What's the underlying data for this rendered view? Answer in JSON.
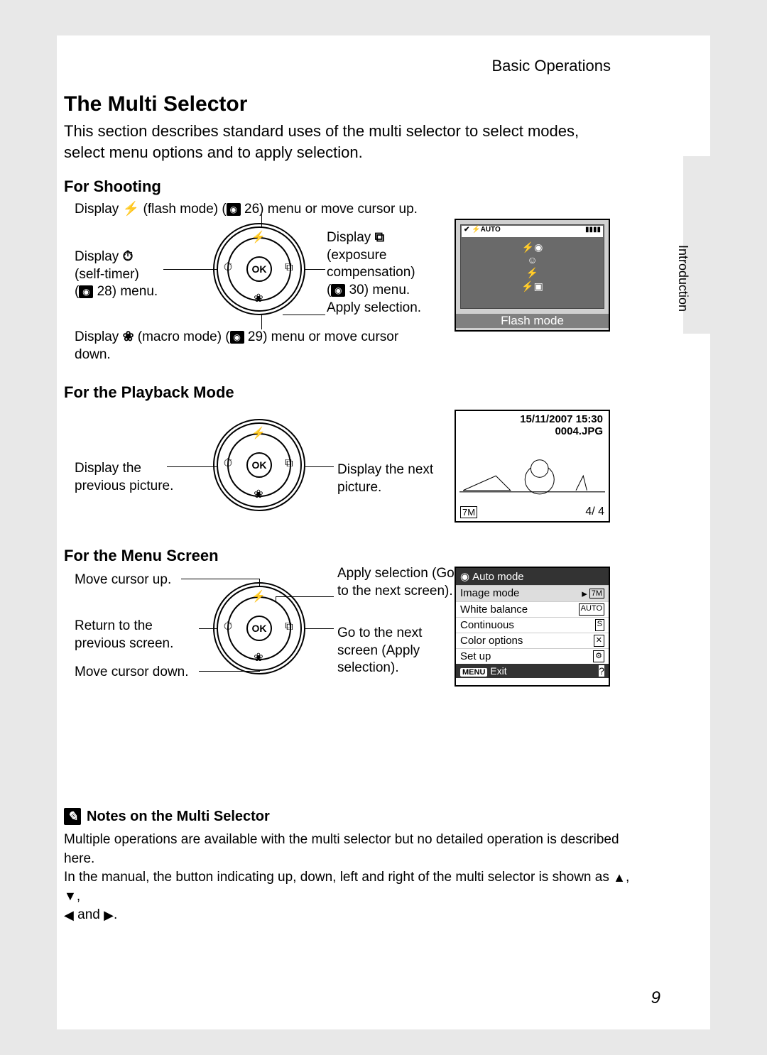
{
  "header": {
    "section": "Basic Operations",
    "sidetab": "Introduction"
  },
  "title": "The Multi Selector",
  "intro": "This section describes standard uses of the multi selector to select modes, select menu options and to apply selection.",
  "shooting": {
    "heading": "For Shooting",
    "top_pre": "Display ",
    "top_mid": " (flash mode) (",
    "top_ref": "26",
    "top_post": ") menu or move cursor up.",
    "left_l1": "Display ",
    "left_l2": "(self-timer)",
    "left_l3_pre": "(",
    "left_l3_ref": "28",
    "left_l3_post": ") menu.",
    "right_l1": "Display ",
    "right_l2": "(exposure",
    "right_l3": "compensation)",
    "right_l4_pre": "(",
    "right_l4_ref": "30",
    "right_l4_post": ") menu.",
    "right_l5": "Apply selection.",
    "bottom_pre": "Display ",
    "bottom_mid": " (macro mode) (",
    "bottom_ref": "29",
    "bottom_post": ") menu or move cursor down."
  },
  "playback": {
    "heading": "For the Playback Mode",
    "left": "Display the previous picture.",
    "right": "Display the next picture."
  },
  "menu": {
    "heading": "For the Menu Screen",
    "left1": "Move cursor up.",
    "left2": "Return to the previous screen.",
    "left3": "Move cursor down.",
    "right1": "Apply selection (Go to the next screen).",
    "right2": "Go to the next screen (Apply selection)."
  },
  "wheel": {
    "ok": "OK"
  },
  "screen_shoot": {
    "top_left": "✔ ⚡AUTO",
    "label": "Flash mode"
  },
  "screen_playback": {
    "date": "15/11/2007 15:30",
    "file": "0004.JPG",
    "res": "7M",
    "count": "4/   4"
  },
  "screen_menu": {
    "title": "Auto mode",
    "items": [
      {
        "label": "Image mode",
        "badge": "7M"
      },
      {
        "label": "White balance",
        "badge": "AUTO"
      },
      {
        "label": "Continuous",
        "badge": "S"
      },
      {
        "label": "Color options",
        "badge": "✕"
      },
      {
        "label": "Set up",
        "badge": "⚙"
      }
    ],
    "foot_menu": "MENU",
    "foot_exit": "Exit",
    "foot_help": "?"
  },
  "notes": {
    "heading": "Notes on the Multi Selector",
    "line1": "Multiple operations are available with the multi selector but no detailed operation is described here.",
    "line2_pre": "In the manual, the button indicating up, down, left and right of the multi selector is shown as ",
    "line2_post": "."
  },
  "page_number": "9"
}
